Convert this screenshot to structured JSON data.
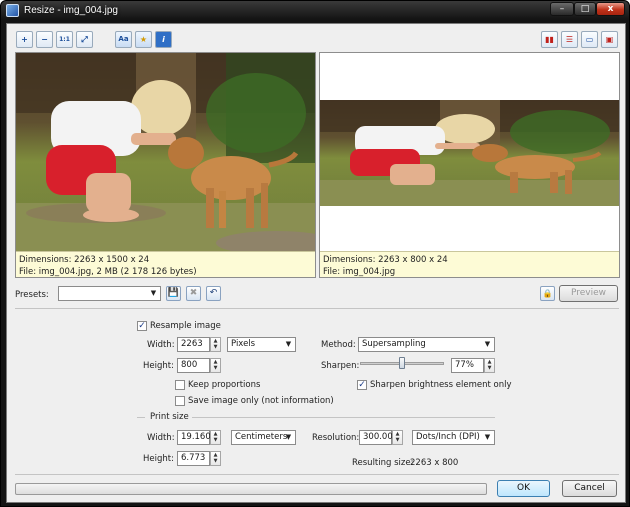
{
  "window": {
    "title": "Resize - img_004.jpg",
    "min": "–",
    "max": "□",
    "close": "x"
  },
  "toolbar": {
    "zoom_in": "+",
    "zoom_out": "−",
    "actual_size": "1:1",
    "fit": "⤢",
    "font": "Aa",
    "star": "★",
    "info": "i"
  },
  "view_buttons": [
    "▮▮",
    "☰",
    "▭",
    "▣"
  ],
  "left_pane": {
    "dimensions": "Dimensions: 2263 x 1500 x 24",
    "file": "File: img_004.jpg, 2 MB (2 178 126 bytes)"
  },
  "right_pane": {
    "dimensions": "Dimensions: 2263 x 800 x 24",
    "file": "File: img_004.jpg"
  },
  "presets": {
    "label": "Presets:",
    "value": "",
    "save": "💾",
    "delete": "✖",
    "revert": "↶"
  },
  "preview": {
    "lock": "🔒",
    "label": "Preview"
  },
  "resample": {
    "label": "Resample image",
    "checked": "✓"
  },
  "width": {
    "label": "Width:",
    "value": "2263",
    "unit": "Pixels"
  },
  "height": {
    "label": "Height:",
    "value": "800"
  },
  "method": {
    "label": "Method:",
    "value": "Supersampling"
  },
  "sharpen": {
    "label": "Sharpen:",
    "value": "77%",
    "level": 0.5
  },
  "keep_proportions": {
    "label": "Keep proportions",
    "checked": ""
  },
  "sharpen_brightness": {
    "label": "Sharpen brightness element only",
    "checked": "✓"
  },
  "save_only": {
    "label": "Save image only (not information)",
    "checked": ""
  },
  "print_size": {
    "label": "Print size",
    "width_label": "Width:",
    "width_value": "19.160",
    "width_unit": "Centimeters",
    "height_label": "Height:",
    "height_value": "6.773",
    "resolution_label": "Resolution:",
    "resolution_value": "300.000",
    "resolution_unit": "Dots/Inch (DPI)",
    "result_label": "Resulting size:",
    "result_value": "2263 x 800"
  },
  "buttons": {
    "ok": "OK",
    "cancel": "Cancel"
  },
  "spin": {
    "up": "▲",
    "down": "▼"
  },
  "arrow": "▼",
  "colors": {
    "info_bg": "#fdfbd6",
    "default_btn": "#3c7fb1"
  }
}
